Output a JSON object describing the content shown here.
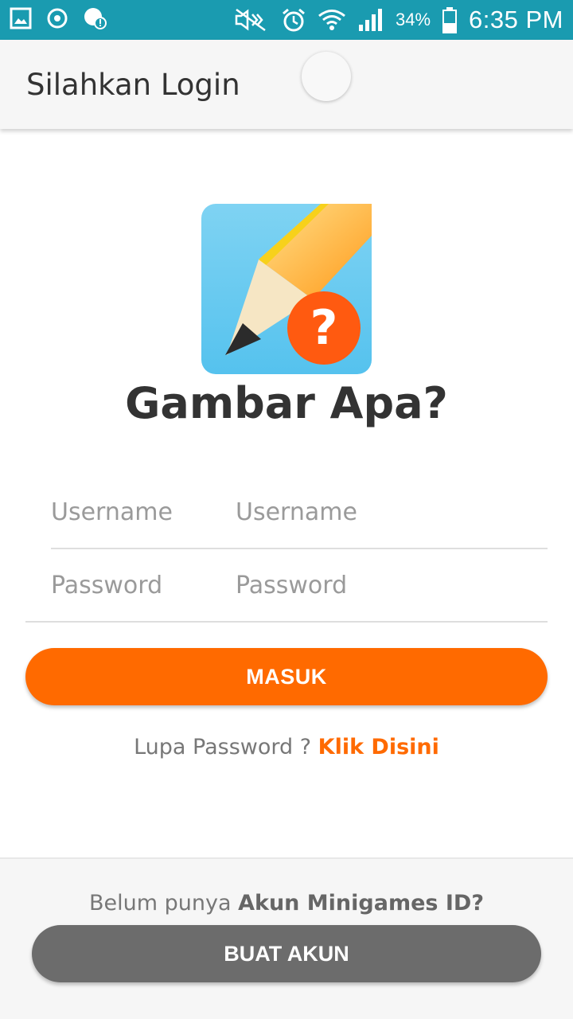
{
  "status_bar": {
    "battery_percent": "34%",
    "time": "6:35 PM",
    "background_color": "#1a9bb0",
    "icons": [
      "gallery-icon",
      "media-icon",
      "notification-icon",
      "mute-icon",
      "alarm-icon",
      "wifi-icon",
      "signal-icon",
      "battery-icon"
    ]
  },
  "app_bar": {
    "title": "Silahkan Login"
  },
  "logo": {
    "app_name": "Gambar Apa?",
    "icon": "pencil-question-icon"
  },
  "form": {
    "username_label": "Username",
    "username_placeholder": "Username",
    "username_value": "",
    "password_label": "Password",
    "password_placeholder": "Password",
    "password_value": "",
    "login_button": "MASUK"
  },
  "forgot": {
    "text": "Lupa Password ? ",
    "link": "Klik Disini"
  },
  "signup": {
    "text": "Belum punya ",
    "strong": "Akun Minigames ID?",
    "button": "BUAT AKUN"
  },
  "colors": {
    "accent": "#ff6a00",
    "secondary_button": "#6c6c6c",
    "status_bar": "#1a9bb0"
  }
}
